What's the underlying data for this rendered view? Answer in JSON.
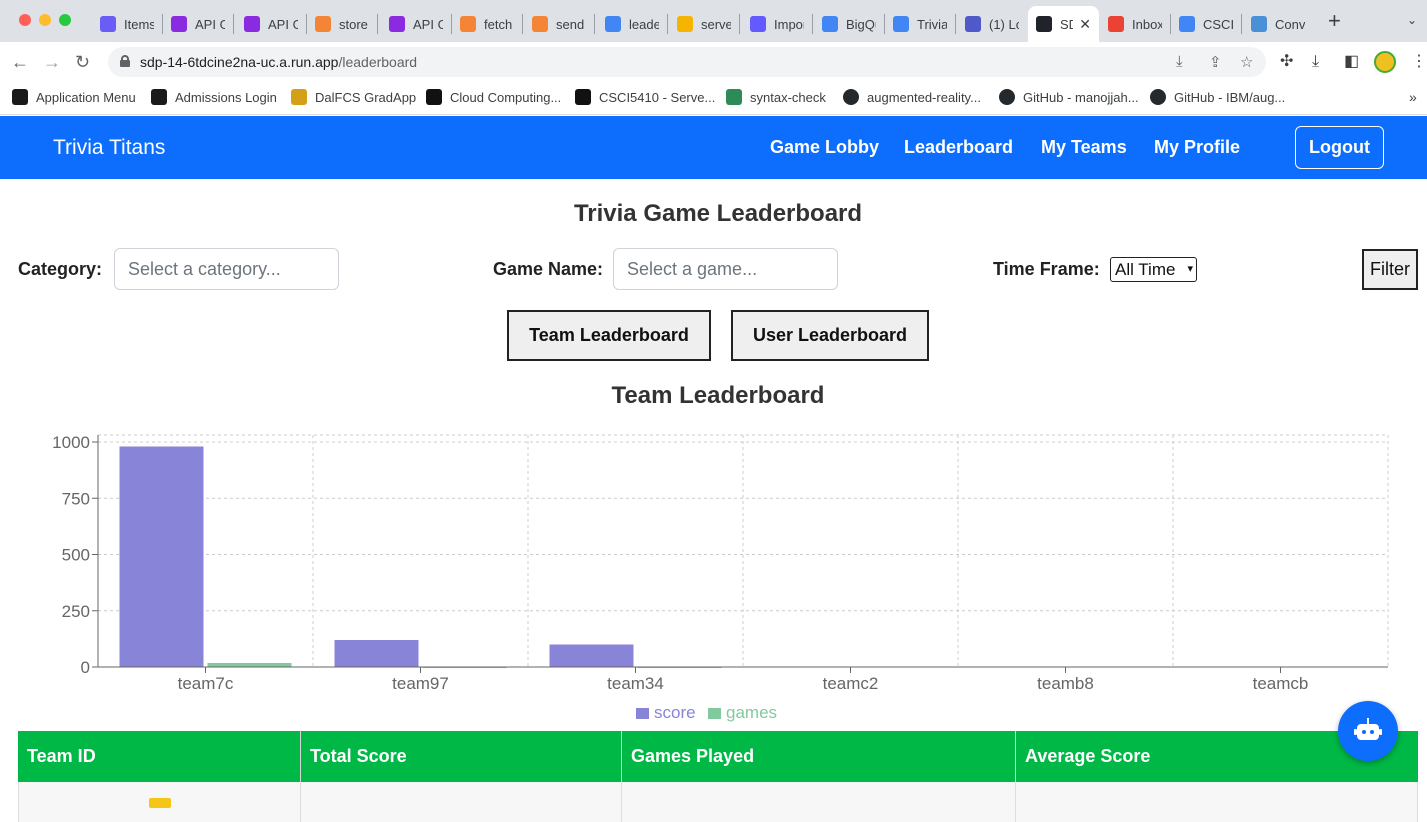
{
  "browser": {
    "tabs": [
      {
        "title": "Items",
        "icon": "document-icon",
        "color": "#6a5cf6"
      },
      {
        "title": "API G",
        "icon": "api-gateway-icon",
        "color": "#8a2be2"
      },
      {
        "title": "API G",
        "icon": "api-gateway-icon",
        "color": "#8a2be2"
      },
      {
        "title": "store",
        "icon": "lambda-icon",
        "color": "#f58536"
      },
      {
        "title": "API G",
        "icon": "api-gateway-icon",
        "color": "#8a2be2"
      },
      {
        "title": "fetch",
        "icon": "lambda-icon",
        "color": "#f58536"
      },
      {
        "title": "send",
        "icon": "lambda-icon",
        "color": "#f58536"
      },
      {
        "title": "leade",
        "icon": "code-icon",
        "color": "#4285f4"
      },
      {
        "title": "serve",
        "icon": "firebase-icon",
        "color": "#f4b400"
      },
      {
        "title": "Impor",
        "icon": "stripe-icon",
        "color": "#635bff"
      },
      {
        "title": "BigQu",
        "icon": "bigquery-icon",
        "color": "#4285f4"
      },
      {
        "title": "Trivia",
        "icon": "ring-icon",
        "color": "#4285f4"
      },
      {
        "title": "(1) Lo",
        "icon": "teams-icon",
        "color": "#5059c9"
      },
      {
        "title": "SD",
        "icon": "react-icon",
        "color": "#20232a",
        "active": true
      },
      {
        "title": "Inbox",
        "icon": "gmail-icon",
        "color": "#ea4335"
      },
      {
        "title": "CSCI-",
        "icon": "docs-icon",
        "color": "#4285f4"
      },
      {
        "title": "Conv",
        "icon": "convert-icon",
        "color": "#4a90d9"
      }
    ],
    "url_host": "sdp-14-6tdcine2na-uc.a.run.app",
    "url_path": "/leaderboard",
    "bookmarks": [
      {
        "label": "Application Menu",
        "icon": "shield-icon"
      },
      {
        "label": "Admissions Login",
        "icon": "shield-icon"
      },
      {
        "label": "DalFCS GradApp",
        "icon": "graduation-cap-icon"
      },
      {
        "label": "Cloud Computing...",
        "icon": "d2l-icon"
      },
      {
        "label": "CSCI5410 - Serve...",
        "icon": "d2l-icon"
      },
      {
        "label": "syntax-check",
        "icon": "syntax-check-icon"
      },
      {
        "label": "augmented-reality...",
        "icon": "github-icon"
      },
      {
        "label": "GitHub - manojjah...",
        "icon": "github-icon"
      },
      {
        "label": "GitHub - IBM/aug...",
        "icon": "github-icon"
      }
    ]
  },
  "navbar": {
    "brand": "Trivia Titans",
    "links": [
      "Game Lobby",
      "Leaderboard",
      "My Teams",
      "My Profile"
    ],
    "logout": "Logout",
    "color": "#0d6efd"
  },
  "page": {
    "title": "Trivia Game Leaderboard",
    "filters": {
      "category_label": "Category:",
      "category_placeholder": "Select a category...",
      "game_label": "Game Name:",
      "game_placeholder": "Select a game...",
      "timeframe_label": "Time Frame:",
      "timeframe_value": "All Time",
      "filter_button": "Filter"
    },
    "buttons": {
      "team": "Team Leaderboard",
      "user": "User Leaderboard"
    },
    "section_title": "Team Leaderboard"
  },
  "chart_data": {
    "type": "bar",
    "categories": [
      "team7c",
      "team97",
      "team34",
      "teamc2",
      "teamb8",
      "teamcb"
    ],
    "series": [
      {
        "name": "score",
        "values": [
          980,
          120,
          100,
          0,
          0,
          0
        ],
        "color": "#8884d8"
      },
      {
        "name": "games",
        "values": [
          18,
          2,
          2,
          0,
          0,
          0
        ],
        "color": "#82ca9d"
      }
    ],
    "yticks": [
      0,
      250,
      500,
      750,
      1000
    ],
    "ylim": [
      0,
      1000
    ],
    "grid": true,
    "legend_position": "bottom-center"
  },
  "table": {
    "headers": [
      "Team ID",
      "Total Score",
      "Games Played",
      "Average Score"
    ],
    "header_color": "#00b845"
  },
  "chatbot": {
    "icon": "robot-icon"
  }
}
